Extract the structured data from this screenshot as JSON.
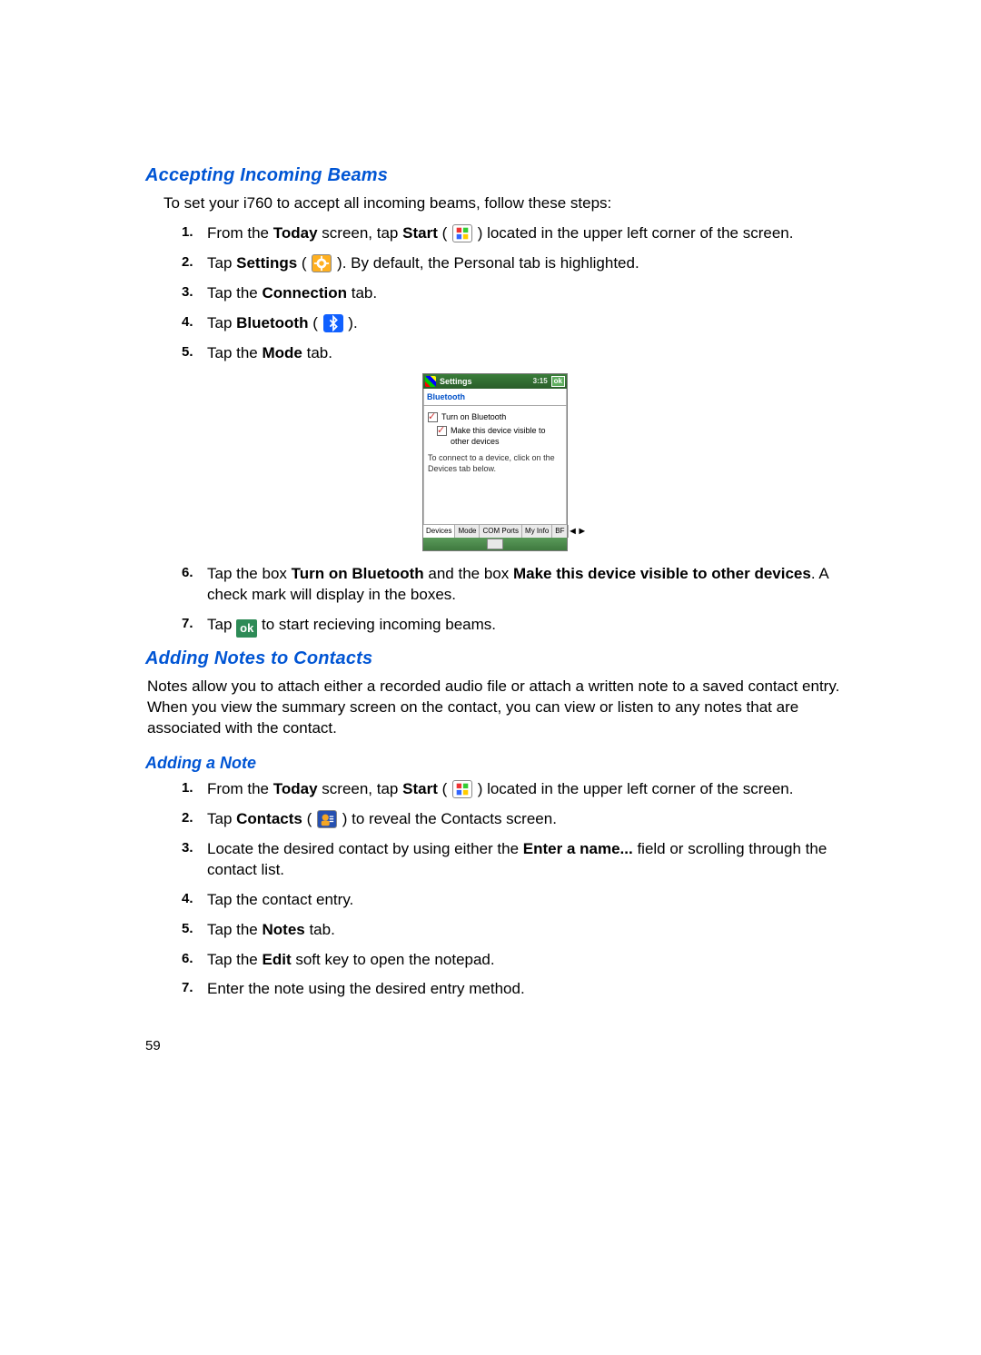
{
  "page_number": "59",
  "sections": {
    "accepting": {
      "heading": "Accepting Incoming Beams",
      "intro": "To set your i760 to accept all incoming beams, follow these steps:",
      "steps": {
        "s1a": "From the ",
        "s1b": "Today",
        "s1c": " screen, tap ",
        "s1d": "Start",
        "s1e": " ( ",
        "s1f": " ) located in the upper left corner of the screen.",
        "s2a": "Tap ",
        "s2b": "Settings",
        "s2c": " ( ",
        "s2d": " ). By default, the Personal tab is highlighted.",
        "s3a": "Tap the ",
        "s3b": "Connection",
        "s3c": " tab.",
        "s4a": "Tap ",
        "s4b": "Bluetooth",
        "s4c": " ( ",
        "s4d": " ).",
        "s5a": "Tap the ",
        "s5b": "Mode",
        "s5c": " tab.",
        "s6a": "Tap the box ",
        "s6b": "Turn on Bluetooth",
        "s6c": " and the box ",
        "s6d": "Make this device visible to other devices",
        "s6e": ".  A check mark will display in the boxes.",
        "s7a": "Tap ",
        "s7b": "ok",
        "s7c": " to start recieving incoming beams."
      }
    },
    "adding_notes": {
      "heading": "Adding Notes to Contacts",
      "intro": "Notes allow you to attach either a recorded audio file or attach a written note to a saved contact entry. When you view the summary screen on the contact, you can view or listen to any notes that are associated with the contact."
    },
    "adding_a_note": {
      "heading": "Adding a Note",
      "steps": {
        "s1a": "From the ",
        "s1b": "Today",
        "s1c": " screen, tap ",
        "s1d": "Start",
        "s1e": " ( ",
        "s1f": " ) located in the upper left corner of the screen.",
        "s2a": "Tap ",
        "s2b": "Contacts",
        "s2c": " ( ",
        "s2d": " ) to reveal the Contacts screen.",
        "s3a": "Locate the desired contact by using either the ",
        "s3b": "Enter a name...",
        "s3c": " field or scrolling through the contact list.",
        "s4": "Tap the contact entry.",
        "s5a": "Tap the ",
        "s5b": "Notes",
        "s5c": " tab.",
        "s6a": "Tap the ",
        "s6b": "Edit",
        "s6c": " soft key to open the notepad.",
        "s7": "Enter the note using the desired entry method."
      }
    }
  },
  "device_screenshot": {
    "title": "Settings",
    "status": "3:15",
    "ok": "ok",
    "section_label": "Bluetooth",
    "cb1": "Turn on Bluetooth",
    "cb2": "Make this device visible to other devices",
    "note": "To connect to a device, click on the Devices tab below.",
    "tabs": [
      "Devices",
      "Mode",
      "COM Ports",
      "My Info",
      "BF"
    ],
    "arrows": [
      "◀",
      "▶"
    ]
  },
  "numbers": {
    "n1": "1.",
    "n2": "2.",
    "n3": "3.",
    "n4": "4.",
    "n5": "5.",
    "n6": "6.",
    "n7": "7."
  }
}
